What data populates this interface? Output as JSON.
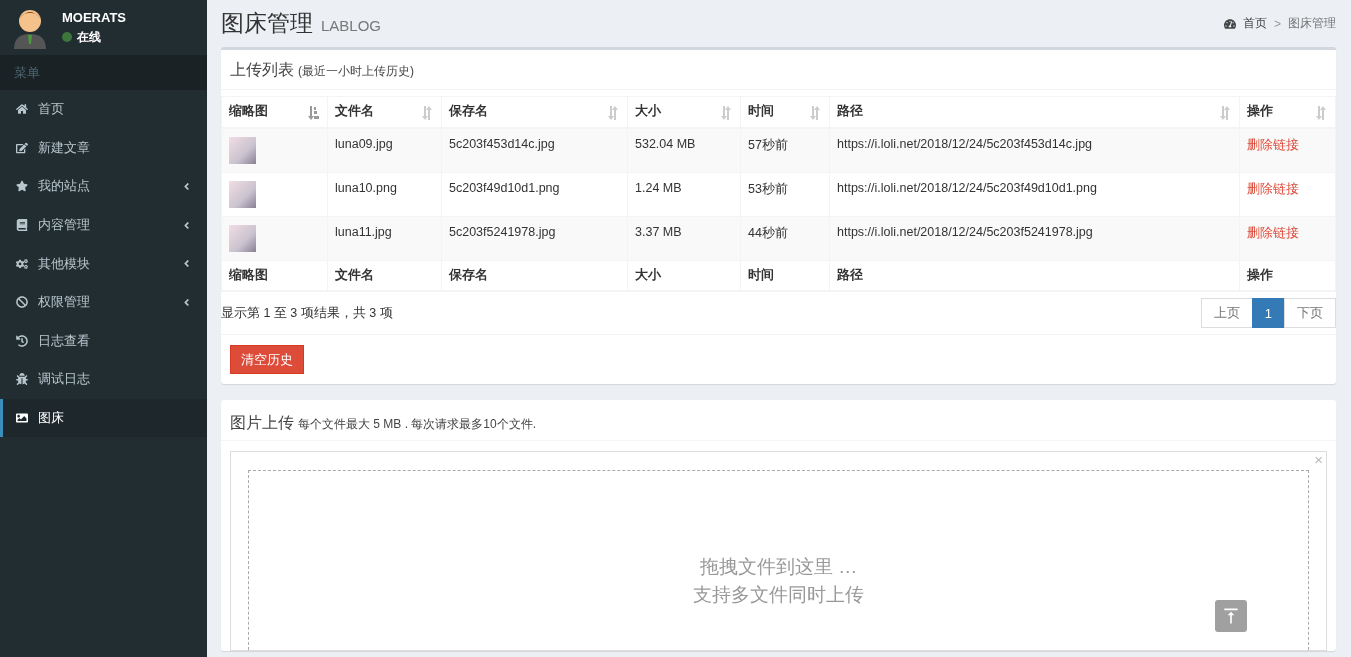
{
  "user": {
    "name": "MOERATS",
    "status": "在线"
  },
  "sidebar": {
    "header": "菜单",
    "items": [
      {
        "label": "首页",
        "submenu": false,
        "selected": false
      },
      {
        "label": "新建文章",
        "submenu": false,
        "selected": false
      },
      {
        "label": "我的站点",
        "submenu": true,
        "selected": false
      },
      {
        "label": "内容管理",
        "submenu": true,
        "selected": false
      },
      {
        "label": "其他模块",
        "submenu": true,
        "selected": false
      },
      {
        "label": "权限管理",
        "submenu": true,
        "selected": false
      },
      {
        "label": "日志查看",
        "submenu": false,
        "selected": false
      },
      {
        "label": "调试日志",
        "submenu": false,
        "selected": false
      },
      {
        "label": "图床",
        "submenu": false,
        "selected": true
      }
    ]
  },
  "page": {
    "title": "图床管理",
    "subtitle": "LABLOG"
  },
  "breadcrumb": {
    "items": [
      "首页",
      "图床管理"
    ],
    "separator": ">"
  },
  "upload_list": {
    "title": "上传列表",
    "subtitle": "(最近一小时上传历史)",
    "columns": [
      {
        "label": "缩略图",
        "sorted": true
      },
      {
        "label": "文件名",
        "sorted": false
      },
      {
        "label": "保存名",
        "sorted": false
      },
      {
        "label": "大小",
        "sorted": false
      },
      {
        "label": "时间",
        "sorted": false
      },
      {
        "label": "路径",
        "sorted": false
      },
      {
        "label": "操作",
        "sorted": false
      }
    ],
    "rows": [
      {
        "file": "luna09.jpg",
        "saved": "5c203f453d14c.jpg",
        "size": "532.04 MB",
        "time": "57秒前",
        "path": "https://i.loli.net/2018/12/24/5c203f453d14c.jpg",
        "action": "删除链接"
      },
      {
        "file": "luna10.png",
        "saved": "5c203f49d10d1.png",
        "size": "1.24 MB",
        "time": "53秒前",
        "path": "https://i.loli.net/2018/12/24/5c203f49d10d1.png",
        "action": "删除链接"
      },
      {
        "file": "luna11.jpg",
        "saved": "5c203f5241978.jpg",
        "size": "3.37 MB",
        "time": "44秒前",
        "path": "https://i.loli.net/2018/12/24/5c203f5241978.jpg",
        "action": "删除链接"
      }
    ],
    "footer": [
      "缩略图",
      "文件名",
      "保存名",
      "大小",
      "时间",
      "路径",
      "操作"
    ],
    "info": "显示第 1 至 3 项结果，共 3 项",
    "pager": [
      {
        "label": "上页",
        "selected": false
      },
      {
        "label": "1",
        "selected": true
      },
      {
        "label": "下页",
        "selected": false
      }
    ],
    "clear_button": "清空历史"
  },
  "upload": {
    "title": "图片上传",
    "note": "每个文件最大 5 MB . 每次请求最多10个文件.",
    "close": "×",
    "drop_lines": [
      "拖拽文件到这里 …",
      "支持多文件同时上传"
    ]
  }
}
